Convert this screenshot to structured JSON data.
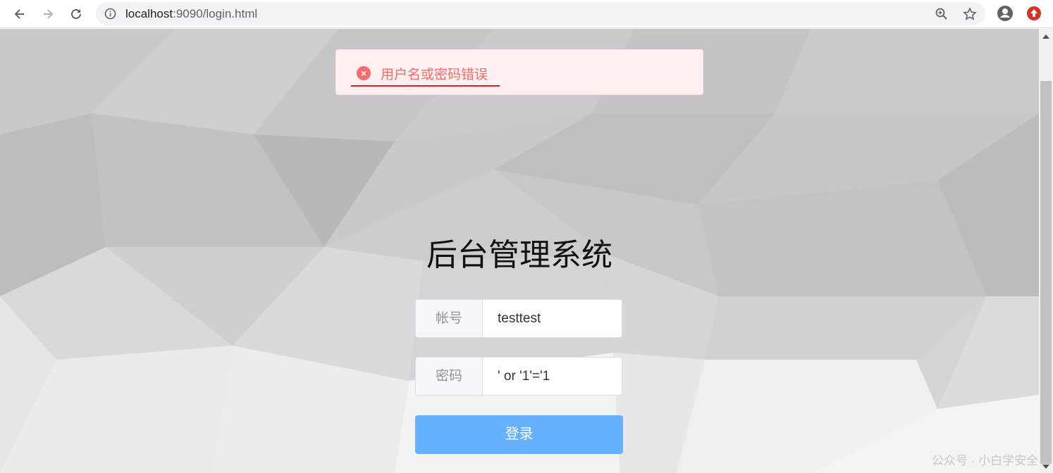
{
  "browser": {
    "url_host": "localhost",
    "url_rest": ":9090/login.html",
    "icons": [
      "back-icon",
      "forward-icon",
      "reload-icon",
      "info-icon",
      "zoom-icon",
      "star-icon",
      "account-icon",
      "extension-icon"
    ]
  },
  "message": {
    "type": "error",
    "text": "用户名或密码错误",
    "color": "#f56c6c"
  },
  "login": {
    "title": "后台管理系统",
    "username_label": "帐号",
    "username_value": "testtest",
    "password_label": "密码",
    "password_value": "' or '1'='1",
    "submit_label": "登录",
    "button_color": "#66b1ff"
  },
  "watermark": "公众号 · 小白学安全"
}
